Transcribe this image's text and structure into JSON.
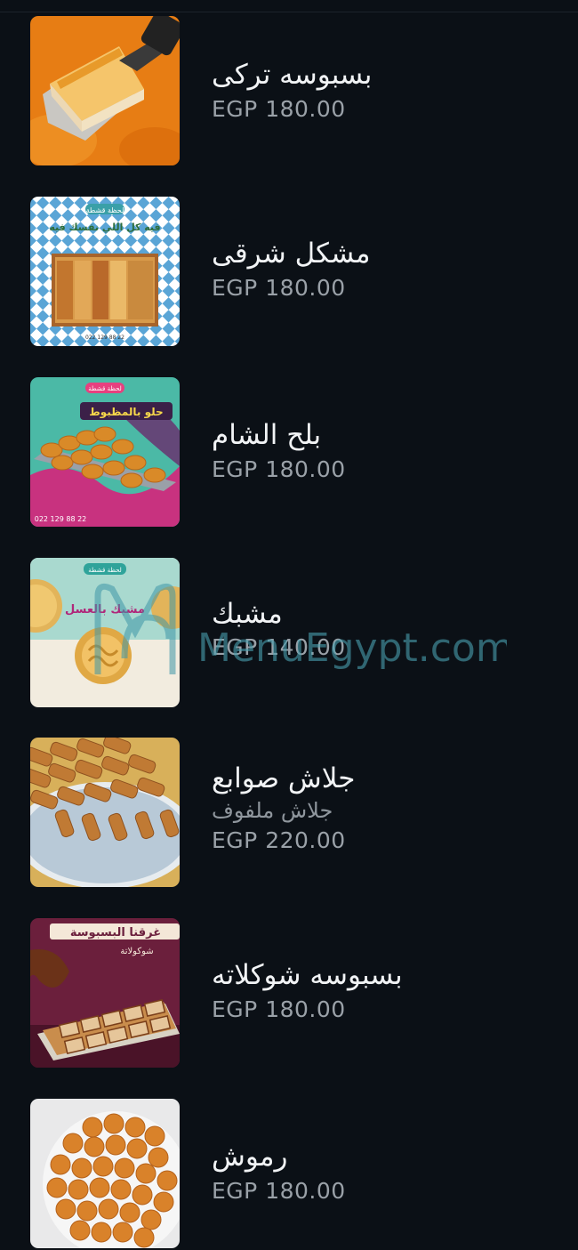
{
  "menu": {
    "items": [
      {
        "name": "بسبوسه تركى",
        "description": "",
        "price": "EGP 180.00",
        "image": "basbousa-turkish-photo"
      },
      {
        "name": "مشكل شرقى",
        "description": "",
        "price": "EGP 180.00",
        "image": "mixed-oriental-sweets-photo",
        "image_text": {
          "brand": "لحظة قشطة",
          "slogan": "فيه كل اللي نفسك فيه",
          "phone": "022 129 88 22"
        }
      },
      {
        "name": "بلح الشام",
        "description": "",
        "price": "EGP 180.00",
        "image": "balah-el-sham-photo",
        "image_text": {
          "brand": "لحظة قشطة",
          "slogan": "حلو بالمظبوط",
          "phone": "022 129 88 22"
        }
      },
      {
        "name": "مشبك",
        "description": "",
        "price": "EGP 140.00",
        "image": "meshabek-photo",
        "image_text": {
          "brand": "لحظة قشطة",
          "slogan": "مشبك بالعسل"
        }
      },
      {
        "name": "جلاش صوابع",
        "description": "جلاش ملفوف",
        "price": "EGP 220.00",
        "image": "gullash-fingers-photo"
      },
      {
        "name": "بسبوسه شوكلاته",
        "description": "",
        "price": "EGP 180.00",
        "image": "chocolate-basbousa-photo",
        "image_text": {
          "headline": "غرقنا البسبوسة",
          "sub": "شوكولاتة"
        }
      },
      {
        "name": "رموش",
        "description": "",
        "price": "EGP 180.00",
        "image": "rmoush-photo"
      }
    ]
  },
  "watermark": {
    "text": "MenuEgypt.com"
  },
  "colors": {
    "background": "#0b1016",
    "name_text": "#f1f3f5",
    "price_text": "#9aa1a8",
    "description_text": "#8f969d"
  }
}
